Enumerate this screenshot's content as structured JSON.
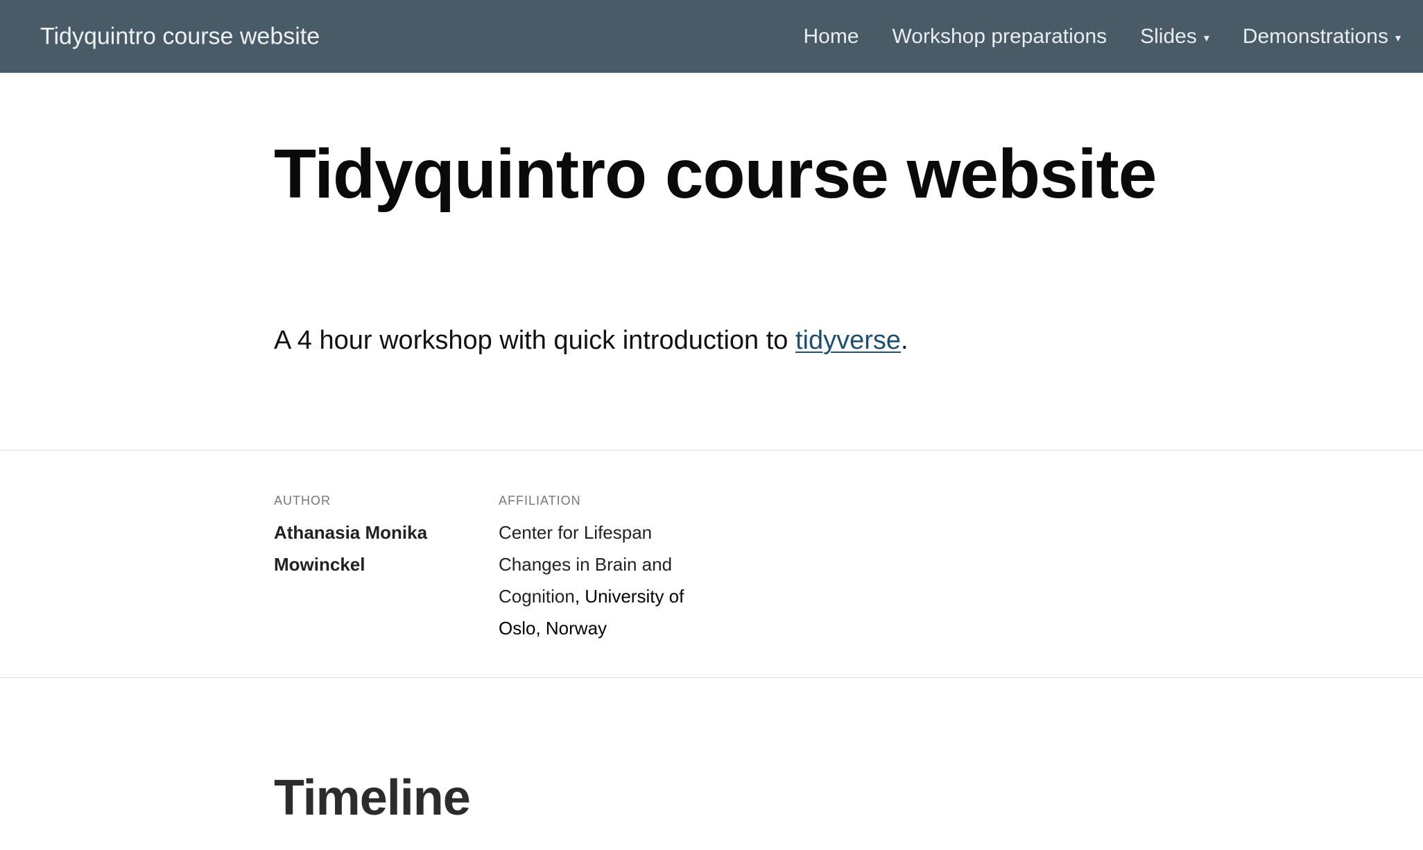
{
  "navbar": {
    "brand": "Tidyquintro course website",
    "items": [
      {
        "label": "Home",
        "has_dropdown": false
      },
      {
        "label": "Workshop preparations",
        "has_dropdown": false
      },
      {
        "label": "Slides",
        "has_dropdown": true
      },
      {
        "label": "Demonstrations",
        "has_dropdown": true
      }
    ],
    "caret": "▾"
  },
  "hero": {
    "title": "Tidyquintro course website",
    "subtitle_prefix": "A 4 hour workshop with quick introduction to ",
    "subtitle_link": "tidyverse",
    "subtitle_suffix": "."
  },
  "meta": {
    "author_label": "Author",
    "author_name": "Athanasia Monika Mowinckel",
    "affiliation_label": "Affiliation",
    "affiliation_main": "Center for Lifespan Changes in Brain and Cognition",
    "affiliation_rest": ", University of Oslo, Norway"
  },
  "section": {
    "title": "Timeline"
  },
  "colors": {
    "navbar_bg": "#485b67",
    "link": "#1f4e73"
  }
}
